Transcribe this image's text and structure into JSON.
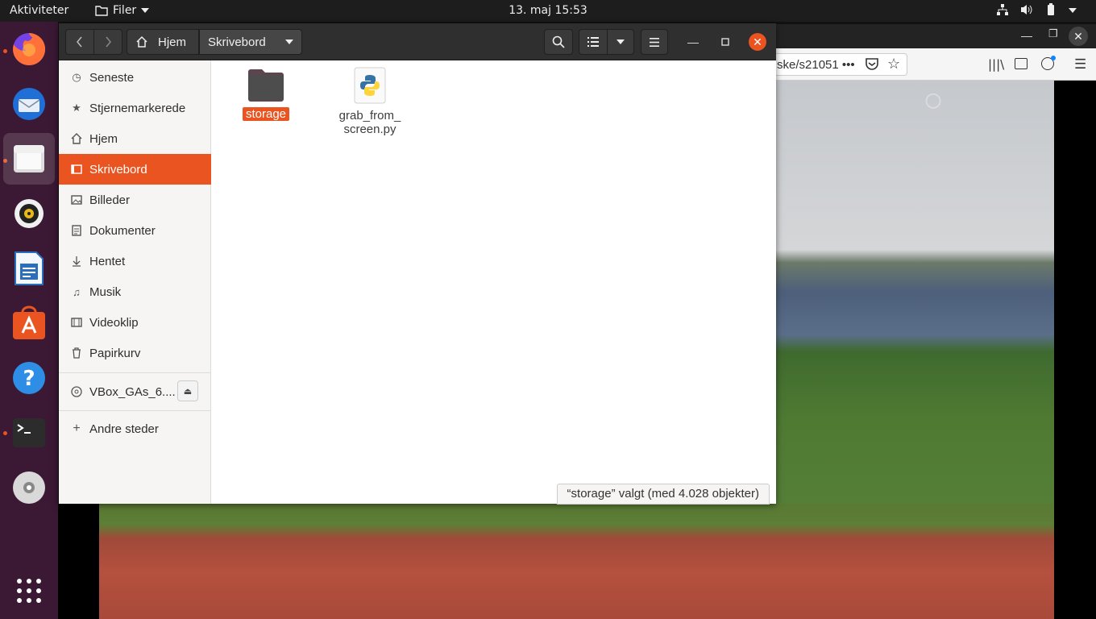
{
  "topbar": {
    "activities": "Aktiviteter",
    "app_menu": "Filer",
    "clock": "13. maj  15:53"
  },
  "dock": {
    "items": [
      "firefox-icon",
      "thunderbird-icon",
      "files-icon",
      "rhythmbox-icon",
      "writer-icon",
      "software-icon",
      "help-icon",
      "terminal-icon",
      "dvd-icon",
      "app-grid-icon"
    ]
  },
  "firefox": {
    "url": "ske/s21051 •••"
  },
  "nautilus": {
    "path_home": "Hjem",
    "path_current": "Skrivebord",
    "sidebar": {
      "items": [
        {
          "label": "Seneste",
          "icon": "clock-icon"
        },
        {
          "label": "Stjernemarkerede",
          "icon": "star-icon"
        },
        {
          "label": "Hjem",
          "icon": "home-icon"
        },
        {
          "label": "Skrivebord",
          "icon": "desktop-icon"
        },
        {
          "label": "Billeder",
          "icon": "pictures-icon"
        },
        {
          "label": "Dokumenter",
          "icon": "documents-icon"
        },
        {
          "label": "Hentet",
          "icon": "download-icon"
        },
        {
          "label": "Musik",
          "icon": "music-icon"
        },
        {
          "label": "Videoklip",
          "icon": "video-icon"
        },
        {
          "label": "Papirkurv",
          "icon": "trash-icon"
        }
      ],
      "device": "VBox_GAs_6....",
      "other": "Andre steder"
    },
    "files": [
      {
        "name": "storage",
        "type": "folder",
        "selected": true
      },
      {
        "name": "grab_from_\nscreen.py",
        "type": "python"
      }
    ],
    "status": "“storage” valgt  (med 4.028 objekter)"
  },
  "colors": {
    "accent": "#e95420",
    "dock_bg": "#3b1833",
    "topbar_bg": "#1d1d1d"
  }
}
